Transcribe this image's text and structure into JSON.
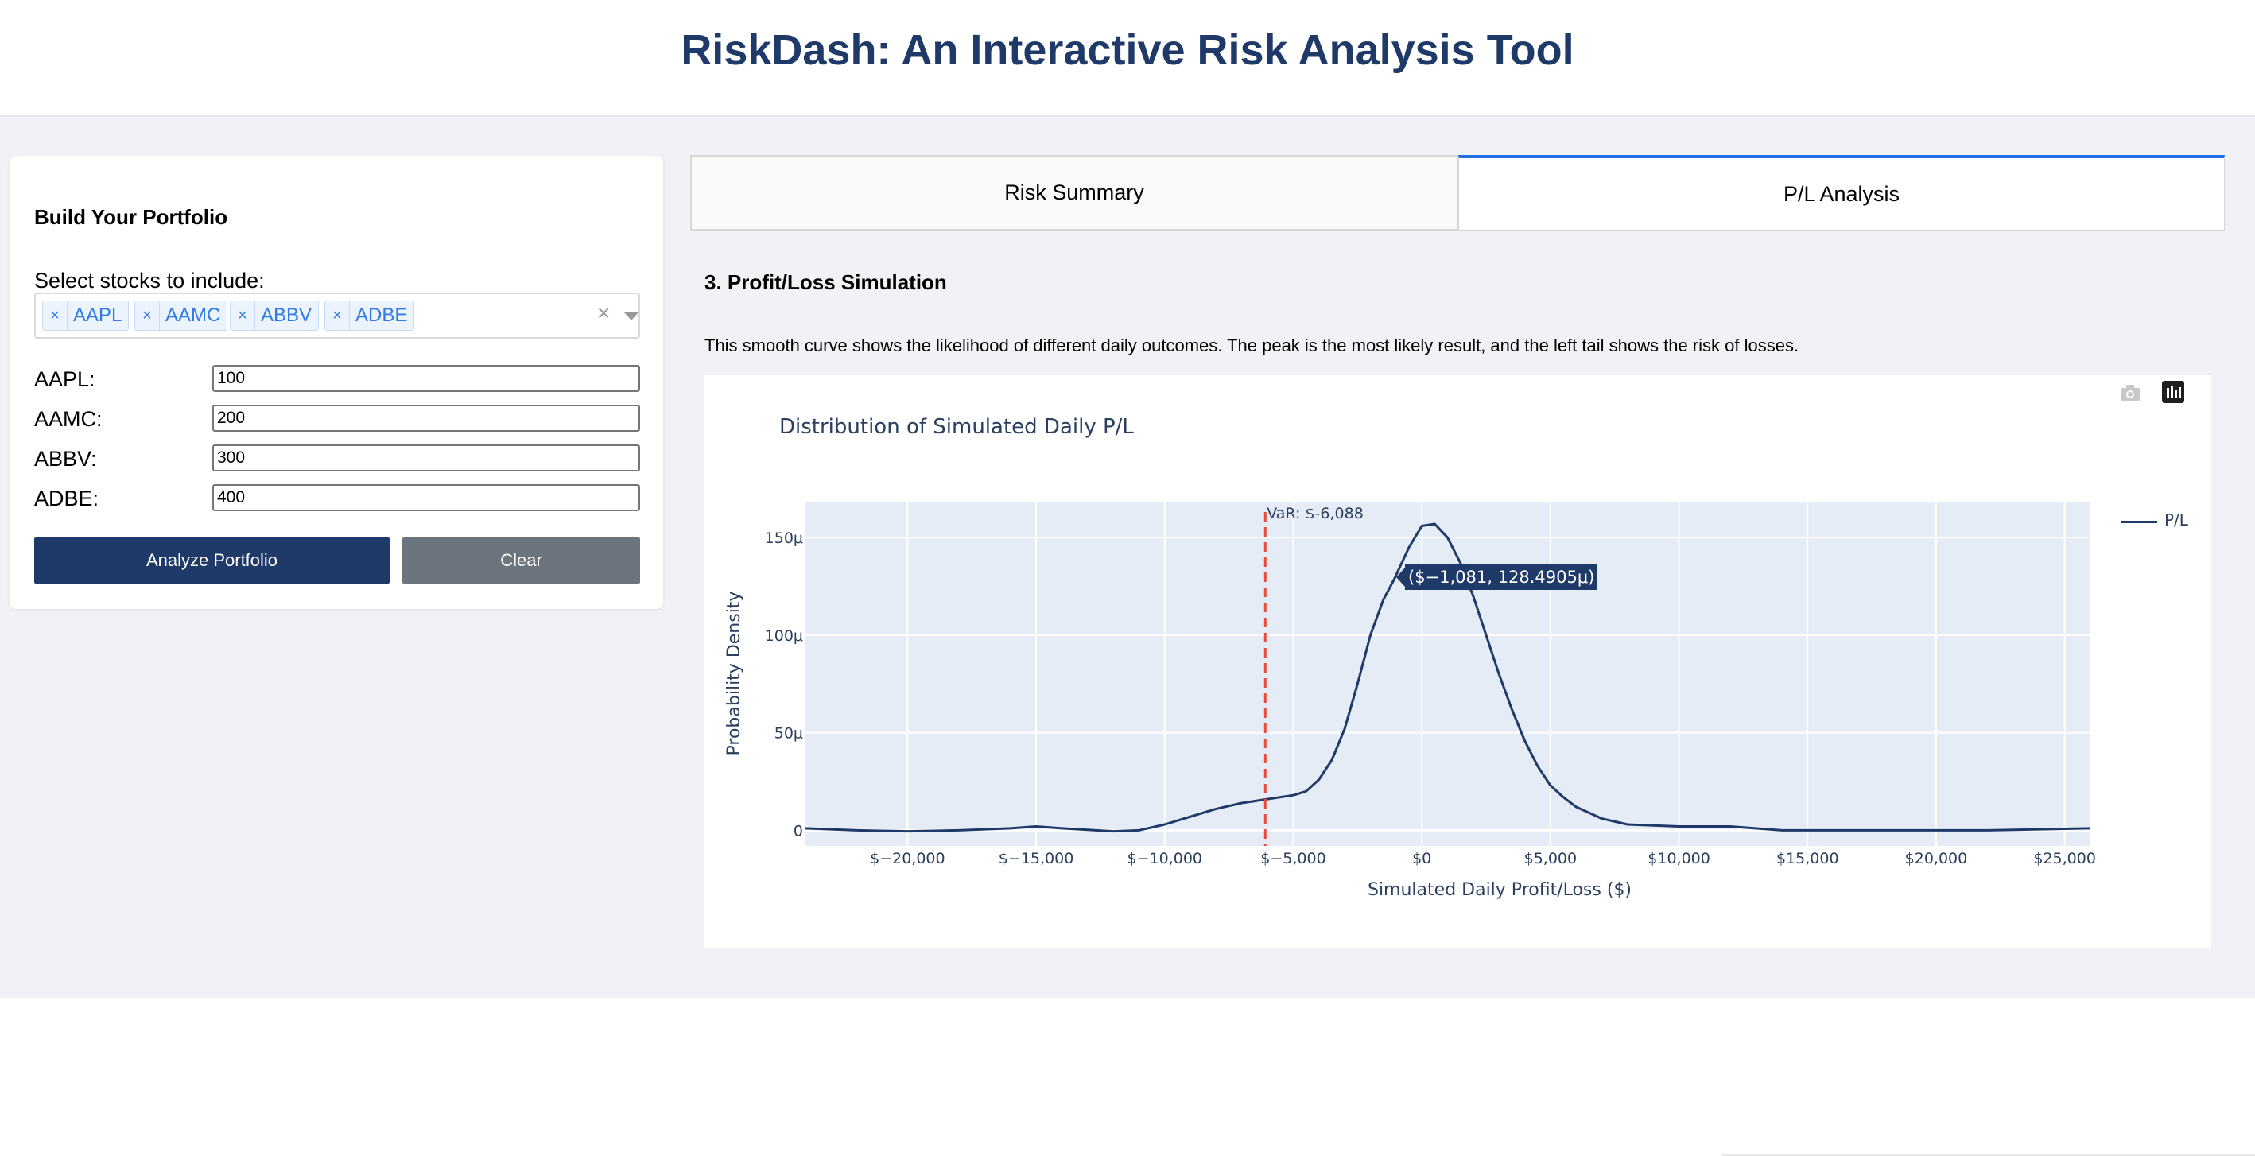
{
  "app": {
    "title": "RiskDash: An Interactive Risk Analysis Tool"
  },
  "sidebar": {
    "title": "Build Your Portfolio",
    "select_label": "Select stocks to include:",
    "selected_stocks": [
      {
        "remove_icon": "×",
        "label": "AAPL"
      },
      {
        "remove_icon": "×",
        "label": "AAMC"
      },
      {
        "remove_icon": "×",
        "label": "ABBV"
      },
      {
        "remove_icon": "×",
        "label": "ADBE"
      }
    ],
    "clear_all_icon": "×",
    "quantities": [
      {
        "label": "AAPL:",
        "value": "100"
      },
      {
        "label": "AAMC:",
        "value": "200"
      },
      {
        "label": "ABBV:",
        "value": "300"
      },
      {
        "label": "ADBE:",
        "value": "400"
      }
    ],
    "analyze_button": "Analyze Portfolio",
    "clear_button": "Clear"
  },
  "tabs": [
    {
      "label": "Risk Summary",
      "active": false
    },
    {
      "label": "P/L Analysis",
      "active": true
    }
  ],
  "section": {
    "title": "3. Profit/Loss Simulation",
    "description": "This smooth curve shows the likelihood of different daily outcomes. The peak is the most likely result, and the left tail shows the risk of losses."
  },
  "chart_data": {
    "type": "line",
    "title": "Distribution of Simulated Daily P/L",
    "xlabel": "Simulated Daily Profit/Loss ($)",
    "ylabel": "Probability Density",
    "xlim": [
      -24000,
      26000
    ],
    "ylim": [
      -8,
      168
    ],
    "x_ticks": [
      -20000,
      -15000,
      -10000,
      -5000,
      0,
      5000,
      10000,
      15000,
      20000,
      25000
    ],
    "x_tick_labels": [
      "$−20,000",
      "$−15,000",
      "$−10,000",
      "$−5,000",
      "$0",
      "$5,000",
      "$10,000",
      "$15,000",
      "$20,000",
      "$25,000"
    ],
    "y_ticks": [
      0,
      50,
      100,
      150
    ],
    "y_tick_labels": [
      "0",
      "50μ",
      "100μ",
      "150μ"
    ],
    "grid": true,
    "legend_position": "top-right",
    "series": [
      {
        "name": "P/L",
        "color": "#1f3a68",
        "x": [
          -24000,
          -22000,
          -20000,
          -18000,
          -16000,
          -15000,
          -14000,
          -12000,
          -11000,
          -10000,
          -9000,
          -8000,
          -7000,
          -6000,
          -5000,
          -4500,
          -4000,
          -3500,
          -3000,
          -2500,
          -2000,
          -1500,
          -1081,
          -500,
          0,
          500,
          1000,
          1500,
          2000,
          2500,
          3000,
          3500,
          4000,
          4500,
          5000,
          5500,
          6000,
          7000,
          8000,
          10000,
          12000,
          14000,
          16000,
          18000,
          20000,
          22000,
          24000,
          26000
        ],
        "y": [
          1,
          0,
          -0.5,
          0,
          1,
          2,
          1,
          -0.5,
          0,
          3,
          7,
          11,
          14,
          16,
          18,
          20,
          26,
          36,
          52,
          75,
          100,
          118,
          128.5,
          145,
          156,
          157,
          150,
          137,
          120,
          100,
          80,
          62,
          46,
          33,
          23,
          17,
          12,
          6,
          3,
          2,
          2,
          0,
          0,
          0,
          0,
          0,
          0.5,
          1
        ]
      }
    ],
    "var_line": {
      "x": -6088,
      "label": "VaR: $-6,088",
      "color": "#e74c3c",
      "style": "dashed"
    },
    "hover": {
      "x": -1081,
      "y": 128.4905,
      "label": "($−1,081, 128.4905μ)"
    }
  }
}
